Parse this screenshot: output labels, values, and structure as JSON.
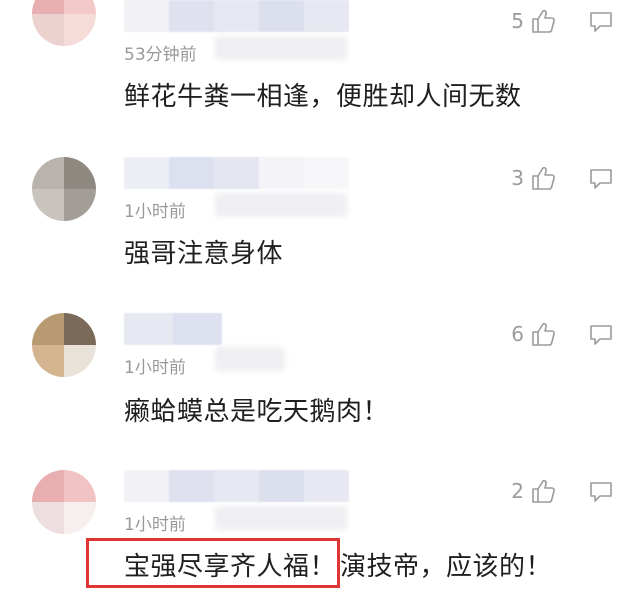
{
  "comments": [
    {
      "time": "53分钟前",
      "text": "鲜花牛粪一相逢，便胜却人间无数",
      "likes": "5"
    },
    {
      "time": "1小时前",
      "text": "强哥注意身体",
      "likes": "3"
    },
    {
      "time": "1小时前",
      "text": "癞蛤蟆总是吃天鹅肉！",
      "likes": "6"
    },
    {
      "time": "1小时前",
      "text_highlighted": "宝强尽享齐人福！",
      "text_rest": "演技帝，应该的！",
      "likes": "2"
    }
  ],
  "icons": {
    "like": "thumbs-up-icon",
    "reply": "comment-bubble-icon"
  },
  "colors": {
    "highlight_border": "#e03535",
    "meta_text": "#999999",
    "icon_stroke": "#9b9b9b"
  }
}
